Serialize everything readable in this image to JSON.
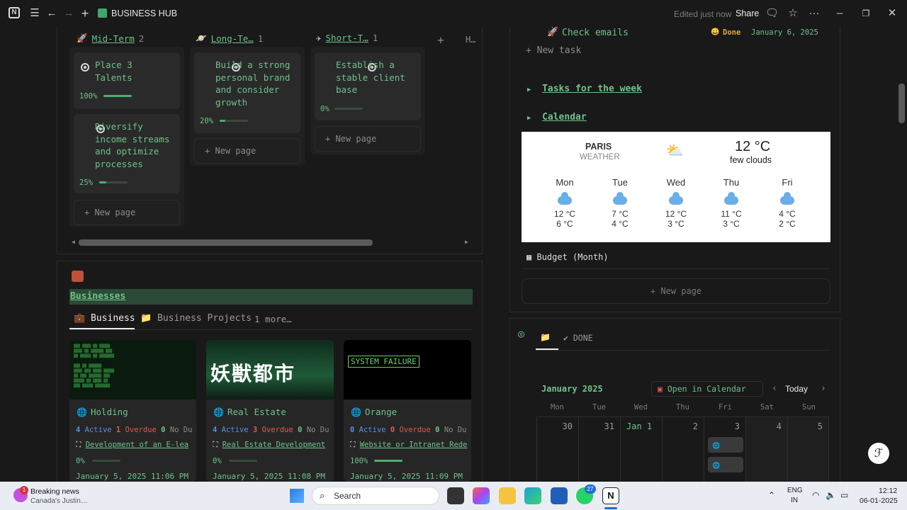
{
  "topbar": {
    "title": "BUSINESS HUB",
    "edited": "Edited just now",
    "share": "Share"
  },
  "board": {
    "columns": [
      {
        "name": "Mid-Term",
        "count": "2"
      },
      {
        "name": "Long-Te…",
        "count": "1"
      },
      {
        "name": "Short-T…",
        "count": "1"
      },
      {
        "name": "H…",
        "count": ""
      }
    ],
    "cards": [
      {
        "title": "Place 3 Talents",
        "progress_label": "100%",
        "progress": 1.0
      },
      {
        "title": "Diversify income streams and optimize processes",
        "progress_label": "25%",
        "progress": 0.25
      },
      {
        "title": "Build a strong personal brand and consider growth",
        "progress_label": "20%",
        "progress": 0.2
      },
      {
        "title": "Establish a stable client base",
        "progress_label": "0%",
        "progress": 0.0
      }
    ],
    "new_page": "New page"
  },
  "businesses": {
    "heading": "Businesses",
    "tabs": [
      "Business",
      "Business Projects",
      "1 more…"
    ],
    "items": [
      {
        "name": "Holding",
        "active": "4",
        "active_label": "Active",
        "overdue": "1",
        "overdue_label": "Overdue",
        "nodue": "0",
        "nodue_label": "No Du",
        "project": "Development of an E-lea",
        "progress_label": "0%",
        "progress": 0.0,
        "date": "January 5, 2025 11:06 PM"
      },
      {
        "name": "Real Estate",
        "active": "4",
        "active_label": "Active",
        "overdue": "3",
        "overdue_label": "Overdue",
        "nodue": "0",
        "nodue_label": "No Du",
        "project": "Real Estate Development",
        "progress_label": "0%",
        "progress": 0.0,
        "date": "January 5, 2025 11:08 PM"
      },
      {
        "name": "Orange",
        "active": "0",
        "active_label": "Active",
        "overdue": "0",
        "overdue_label": "Overdue",
        "nodue": "0",
        "nodue_label": "No Du",
        "project": "Website or Intranet Rede",
        "progress_label": "100%",
        "progress": 1.0,
        "date": "January 5, 2025 11:09 PM"
      }
    ],
    "cover_text_2": "妖獣都市",
    "cover_text_3": "SYSTEM FAILURE"
  },
  "tasks": {
    "item": "Check emails",
    "status": "Done",
    "date": "January 6, 2025",
    "new_task": "New task",
    "toggle1": "Tasks for the week",
    "toggle2": "Calendar"
  },
  "weather": {
    "city": "PARIS",
    "sub": "WEATHER",
    "temp": "12 °C",
    "desc": "few clouds",
    "days": [
      {
        "d": "Mon",
        "hi": "12 °C",
        "lo": "6 °C"
      },
      {
        "d": "Tue",
        "hi": "7 °C",
        "lo": "4 °C"
      },
      {
        "d": "Wed",
        "hi": "12 °C",
        "lo": "3 °C"
      },
      {
        "d": "Thu",
        "hi": "11 °C",
        "lo": "3 °C"
      },
      {
        "d": "Fri",
        "hi": "4 °C",
        "lo": "2 °C"
      }
    ]
  },
  "budget": {
    "label": "Budget (Month)",
    "new_page": "New page"
  },
  "calendar": {
    "tab_done": "DONE",
    "month": "January 2025",
    "open": "Open in Calendar",
    "today": "Today",
    "weekdays": [
      "Mon",
      "Tue",
      "Wed",
      "Thu",
      "Fri",
      "Sat",
      "Sun"
    ],
    "dates": [
      "30",
      "31",
      "Jan 1",
      "2",
      "3",
      "4",
      "5"
    ]
  },
  "taskbar": {
    "news_title": "Breaking news",
    "news_sub": "Canada's Justin…",
    "news_badge": "1",
    "search": "Search",
    "lang1": "ENG",
    "lang2": "IN",
    "time": "12:12",
    "date": "06-01-2025",
    "whatsapp_badge": "27"
  },
  "colors": {
    "accent": "#6ec28a",
    "bg": "#191919",
    "overdue": "#e05a4f",
    "active": "#5b8de0"
  }
}
